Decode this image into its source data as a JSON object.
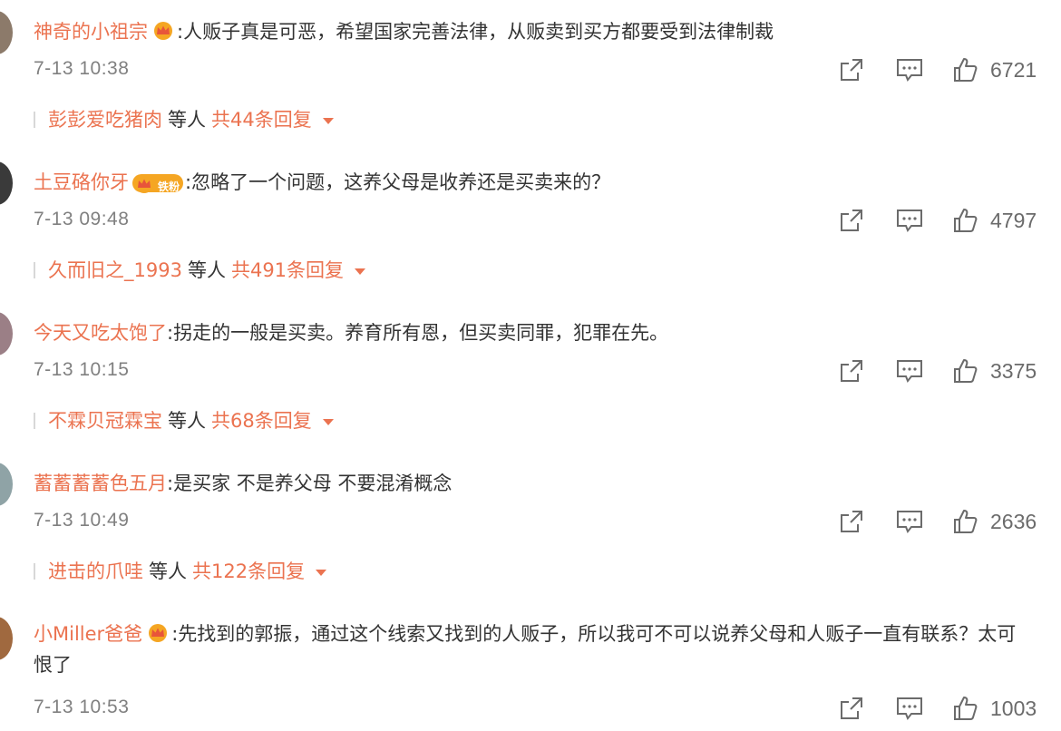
{
  "comments": [
    {
      "user": "神奇的小祖宗",
      "separator": ":",
      "text": "人贩子真是可恶，希望国家完善法律，从贩卖到买方都要受到法律制裁",
      "has_crown": true,
      "badge_label": "",
      "time": "7-13 10:38",
      "likes": "6721",
      "reply_user": "彭彭爱吃猪肉",
      "reply_mid": "等人",
      "reply_total": "共44条回复"
    },
    {
      "user": "土豆硌你牙",
      "separator": ":",
      "text": "忽略了一个问题，这养父母是收养还是买卖来的？",
      "has_crown": true,
      "badge_label": "铁粉",
      "time": "7-13 09:48",
      "likes": "4797",
      "reply_user": "久而旧之_1993",
      "reply_mid": "等人",
      "reply_total": "共491条回复"
    },
    {
      "user": "今天又吃太饱了",
      "separator": ":",
      "text": "拐走的一般是买卖。养育所有恩，但买卖同罪，犯罪在先。",
      "has_crown": false,
      "badge_label": "",
      "time": "7-13 10:15",
      "likes": "3375",
      "reply_user": "不霖贝冠霖宝",
      "reply_mid": "等人",
      "reply_total": "共68条回复"
    },
    {
      "user": "蓄蓄蓄蓄色五月",
      "separator": ":",
      "text": "是买家 不是养父母 不要混淆概念",
      "has_crown": false,
      "badge_label": "",
      "time": "7-13 10:49",
      "likes": "2636",
      "reply_user": "进击的爪哇",
      "reply_mid": "等人",
      "reply_total": "共122条回复"
    },
    {
      "user": "小Miller爸爸",
      "separator": ":",
      "text": "先找到的郭振，通过这个线索又找到的人贩子，所以我可不可以说养父母和人贩子一直有联系？太可恨了",
      "has_crown": true,
      "badge_label": "",
      "time": "7-13 10:53",
      "likes": "1003"
    }
  ],
  "colors": {
    "username": "#eb7350",
    "text": "#333333",
    "meta": "#808080",
    "icon": "#6b6b6b",
    "crown": "#f5a623"
  },
  "icons": [
    "share-icon",
    "comment-icon",
    "like-icon",
    "crown-icon",
    "caret-down-icon"
  ]
}
